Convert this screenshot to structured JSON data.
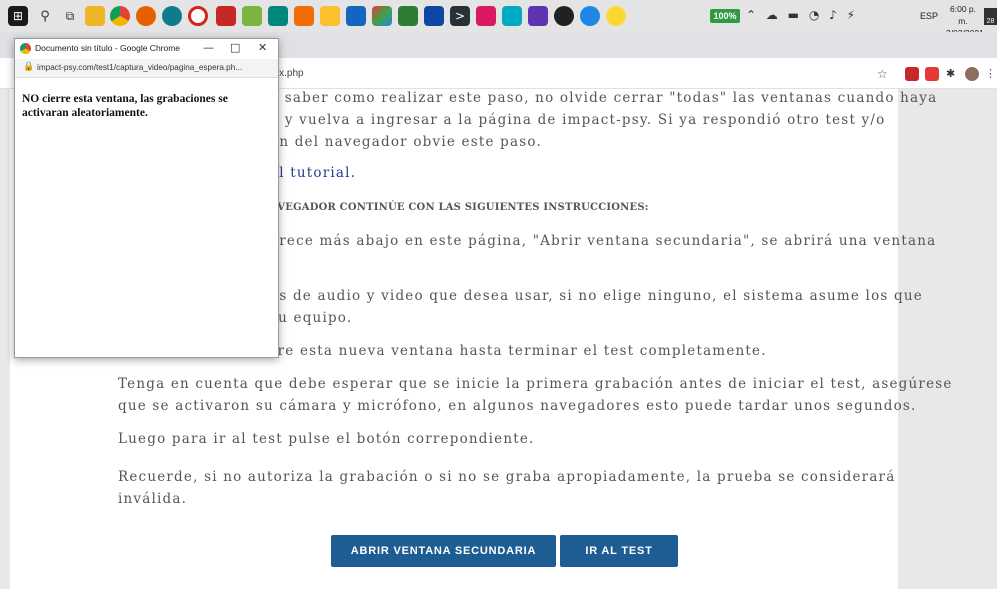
{
  "taskbar": {
    "icons": [
      "windows-icon",
      "search-icon",
      "task-view-icon",
      "file-explorer-icon",
      "chrome-icon",
      "firefox-icon",
      "edge-icon",
      "opera-icon",
      "app-red-icon",
      "app-green-icon",
      "app-teal-icon",
      "app-orange-icon",
      "app-pencil-icon",
      "mail-icon",
      "app-multicolor-icon",
      "app-green2-icon",
      "app-blue-icon",
      "terminal-icon",
      "app-pink-icon",
      "app-cyan-icon",
      "app-purple-icon",
      "app-black-icon",
      "app-blue2-icon",
      "app-yellow-icon"
    ],
    "battery": "100%",
    "language": "ESP",
    "time": "6:00 p. m.",
    "date": "3/03/2021",
    "notification_count": "28"
  },
  "main_browser": {
    "url_fragment": "dex.php"
  },
  "popup": {
    "title": "Documento sin título - Google Chrome",
    "url": "impact-psy.com/test1/captura_video/pagina_espera.ph...",
    "message": "NO cierre esta ventana, las grabaciones se activaran aleatoriamente."
  },
  "page": {
    "line1": "a saber como realizar este paso, no olvide cerrar \"todas\" las ventanas cuando haya",
    "line2": "o y vuelva a ingresar a la página de impact-psy. Si ya respondió otro test y/o",
    "line3": "ón del navegador obvie este paso.",
    "tutorial_link": "al tutorial.",
    "caps_heading": "AVEGADOR CONTINÚE CON LAS SIGUIENTES INSTRUCCIONES:",
    "step1_a": "arece más abajo en este página, \"Abrir ventana secundaria\", se abrirá una ventana",
    "step1_b": ".",
    "step2_a": "os de audio y video que desea usar, si no elige ninguno, el sistema asume los que",
    "step2_b": "su equipo.",
    "step3": "rre esta nueva ventana hasta terminar el test completamente.",
    "note1_a": "Tenga en cuenta que debe esperar que se inicie la primera grabación antes de iniciar el test, asegúrese",
    "note1_b": "que se activaron su cámara y micrófono, en algunos navegadores esto puede tardar unos segundos.",
    "note2": "Luego para ir al test pulse el botón correpondiente.",
    "note3_a": "Recuerde, si no autoriza la grabación o si no se graba apropiadamente, la prueba se considerará",
    "note3_b": "inválida.",
    "btn_secondary": "ABRIR VENTANA SECUNDARIA",
    "btn_test": "IR AL TEST"
  },
  "colors": {
    "button": "#1e5d94",
    "link": "#1f3f8f",
    "battery": "#2e9a44"
  }
}
